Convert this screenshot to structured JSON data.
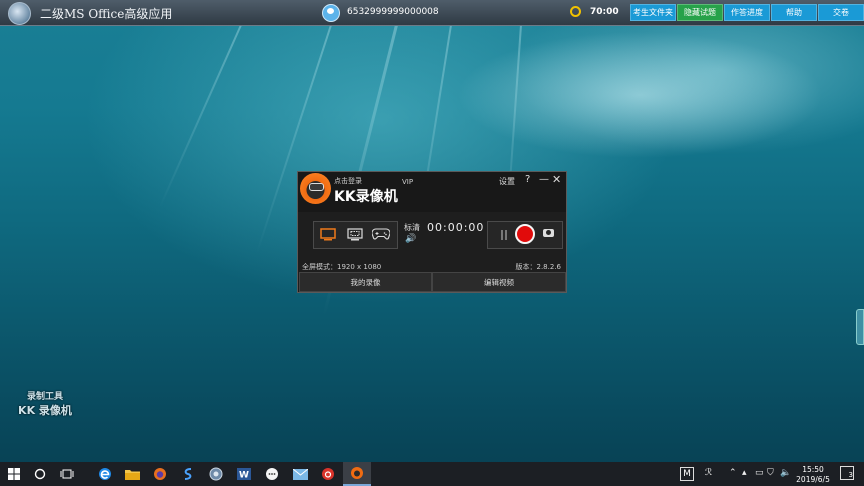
{
  "topbar": {
    "app_title": "二级MS Office高级应用",
    "user_id": "6532999999000008",
    "timer": "70:00",
    "buttons": [
      {
        "label": "考生文件夹",
        "color": "#1a9ad6"
      },
      {
        "label": "隐藏试题",
        "color": "#27a24a"
      },
      {
        "label": "作答进度",
        "color": "#1a9ad6"
      },
      {
        "label": "帮助",
        "color": "#1a9ad6"
      },
      {
        "label": "交卷",
        "color": "#1a9ad6"
      }
    ]
  },
  "recorder": {
    "login_link": "点击登录",
    "app_name": "KK录像机",
    "vip": "VIP",
    "settings": "设置",
    "help": "?",
    "minimize": "—",
    "close": "✕",
    "quality": "标清",
    "volume_icon": "🔊",
    "elapsed": "00:00:00",
    "status": "全屏模式：1920 x 1080",
    "version": "版本：2.8.2.6",
    "tab_my_videos": "我的录像",
    "tab_edit_video": "编辑视频"
  },
  "watermark": {
    "line1": "录制工具",
    "line2": "KK 录像机"
  },
  "taskbar": {
    "clock_time": "15:50",
    "clock_date": "2019/6/5",
    "ime": "M",
    "notification_count": "3",
    "icons": [
      "windows-start-icon",
      "cortana-icon",
      "task-view-icon",
      "edge-icon",
      "file-explorer-icon",
      "firefox-icon",
      "s-app-icon",
      "exam-app-icon",
      "word-icon",
      "chat-bubble-icon",
      "mail-icon",
      "netease-music-icon",
      "kk-recorder-icon"
    ]
  },
  "colors": {
    "topbar": "#3a4651",
    "recorder_bg": "#1e1e1e",
    "record_button": "#e10b0b",
    "accent_orange": "#f06b12"
  }
}
